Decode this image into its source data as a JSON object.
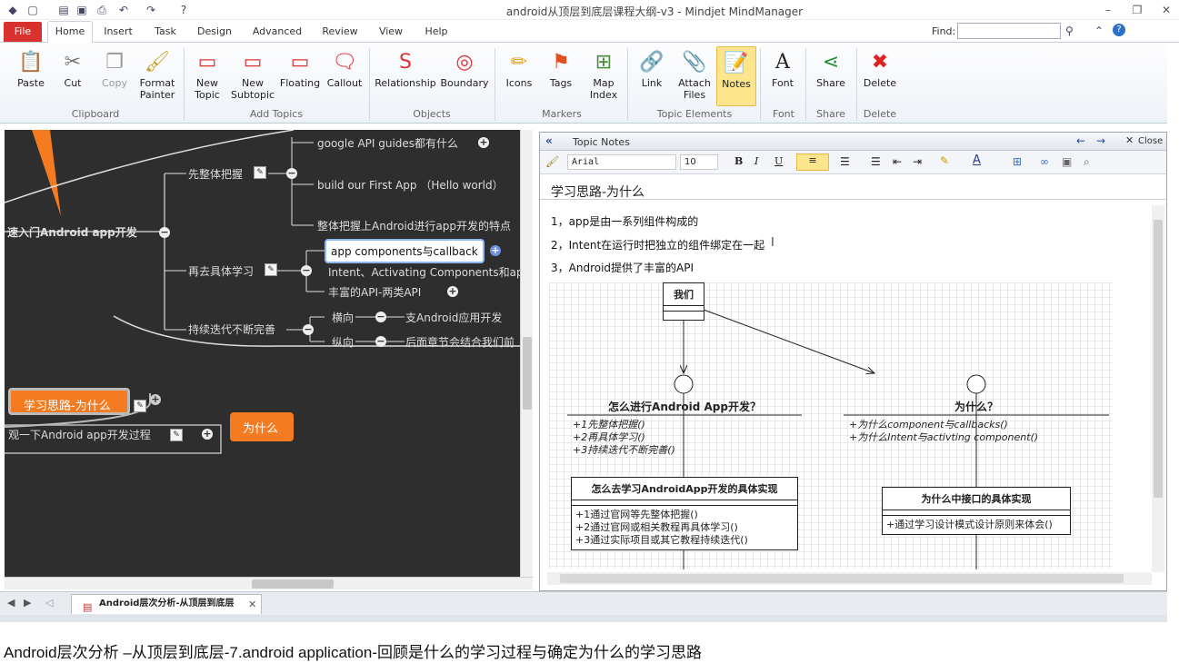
{
  "window": {
    "title": "android从顶层到底层课程大纲-v3 - Mindjet MindManager"
  },
  "ribbon_tabs": [
    "File",
    "Home",
    "Insert",
    "Task",
    "Design",
    "Advanced",
    "Review",
    "View",
    "Help"
  ],
  "find": {
    "label": "Find:",
    "value": ""
  },
  "ribbon": {
    "paste": "Paste",
    "cut": "Cut",
    "copy": "Copy",
    "format_painter_1": "Format",
    "format_painter_2": "Painter",
    "new_topic_1": "New",
    "new_topic_2": "Topic",
    "new_subtopic_1": "New",
    "new_subtopic_2": "Subtopic",
    "floating": "Floating",
    "callout": "Callout",
    "relationship": "Relationship",
    "boundary": "Boundary",
    "icons": "Icons",
    "tags": "Tags",
    "map_index_1": "Map",
    "map_index_2": "Index",
    "link": "Link",
    "attach_1": "Attach",
    "attach_2": "Files",
    "notes": "Notes",
    "font": "Font",
    "share": "Share",
    "delete": "Delete",
    "groups": {
      "clipboard": "Clipboard",
      "add_topics": "Add Topics",
      "objects": "Objects",
      "markers": "Markers",
      "topic_elements": "Topic Elements",
      "font": "Font",
      "share": "Share",
      "delete": "Delete"
    }
  },
  "mindmap": {
    "main_topic": "速入门Android app开发",
    "n_overall": "先整体把握",
    "n_google": "google API guides都有什么",
    "n_first_app": "build our First App （Hello world）",
    "n_features": "整体把握上Android进行app开发的特点",
    "n_detail": "再去具体学习",
    "n_components": "app components与callback",
    "n_intent": "Intent、Activating Components和ap",
    "n_api": "丰富的API-两类API",
    "n_iterate": "持续迭代不断完善",
    "n_horizontal": "横向",
    "n_horizontal_child": "支Android应用开发",
    "n_vertical": "纵向",
    "n_vertical_child": "后面章节会结合我们前",
    "n_why_path": "学习思路-为什么",
    "n_review": "观一下Android app开发过程",
    "n_why": "为什么"
  },
  "notes_panel": {
    "header": "Topic Notes",
    "close": "Close",
    "font_name": "Arial",
    "font_size": "10",
    "title": "学习思路-为什么",
    "lines": [
      "1，app是由一系列组件构成的",
      "2，Intent在运行时把独立的组件绑定在一起",
      "3，Android提供了丰富的API"
    ]
  },
  "diagram": {
    "we": "我们",
    "how_title": "怎么进行Android App开发？",
    "how_items": [
      "+1先整体把握()",
      "+2再具体学习()",
      "+3持续迭代不断完善()"
    ],
    "why_title": "为什么？",
    "why_items": [
      "+为什么component与callbacks()",
      "+为什么Intent与activting component()"
    ],
    "impl_title": "怎么去学习AndroidApp开发的具体实现",
    "impl_items": [
      "+1通过官网等先整体把握()",
      "+2通过官网或相关教程再具体学习()",
      "+3通过实际项目或其它教程持续迭代()"
    ],
    "iface_title": "为什么中接口的具体实现",
    "iface_items": [
      "+通过学习设计模式设计原则来体会()"
    ]
  },
  "doc_tab": "Android层次分析-从顶层到底层",
  "caption": "Android层次分析 –从顶层到底层-7.android application-回顾是什么的学习过程与确定为什么的学习思路",
  "colors": {
    "file_tab": "#d9322e",
    "map_bg": "#2e2e2e",
    "orange_topic": "#f47b20",
    "notes_active": "#fce58c"
  }
}
